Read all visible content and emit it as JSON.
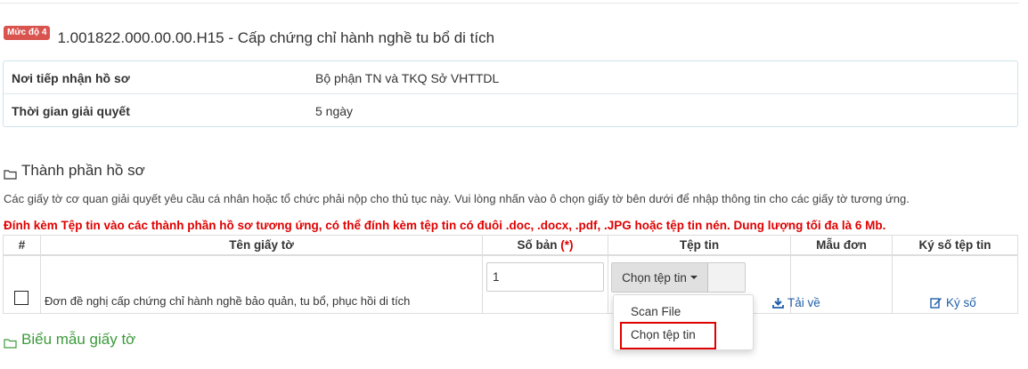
{
  "header": {
    "level_badge": "Mức độ 4",
    "title": "1.001822.000.00.00.H15 - Cấp chứng chỉ hành nghề tu bổ di tích"
  },
  "info": {
    "rows": [
      {
        "label": "Nơi tiếp nhận hồ sơ",
        "value": "Bộ phận TN và TKQ Sở VHTTDL"
      },
      {
        "label": "Thời gian giải quyết",
        "value": "5 ngày"
      }
    ]
  },
  "documents_section": {
    "heading": "Thành phần hồ sơ",
    "description": "Các giấy tờ cơ quan giải quyết yêu cầu cá nhân hoặc tổ chức phải nộp cho thủ tục này. Vui lòng nhấn vào ô chọn giấy tờ bên dưới để nhập thông tin cho các giấy tờ tương ứng.",
    "warning": "Đính kèm Tệp tin vào các thành phần hồ sơ tương ứng, có thể đính kèm tệp tin có đuôi .doc, .docx, .pdf, .JPG hoặc tệp tin nén. Dung lượng tối đa là 6 Mb.",
    "table": {
      "headers": {
        "index": "#",
        "name": "Tên giấy tờ",
        "copies": "Số bản",
        "copies_required": "(*)",
        "file": "Tệp tin",
        "template": "Mẫu đơn",
        "sign": "Ký số tệp tin"
      },
      "rows": [
        {
          "name": "Đơn đề nghị cấp chứng chỉ hành nghề bảo quản, tu bổ, phục hồi di tích",
          "copies": "1",
          "file_button": "Chọn tệp tin",
          "template_link": "Tải về",
          "sign_link": "Ký số"
        }
      ]
    },
    "file_menu": {
      "items": [
        "Scan File",
        "Chọn tệp tin"
      ]
    }
  },
  "templates_section": {
    "heading": "Biểu mẫu giấy tờ"
  },
  "colors": {
    "badge": "#d9534f",
    "warning": "#e00000",
    "link": "#1f5fa8",
    "green_heading": "#3c9a3c"
  }
}
